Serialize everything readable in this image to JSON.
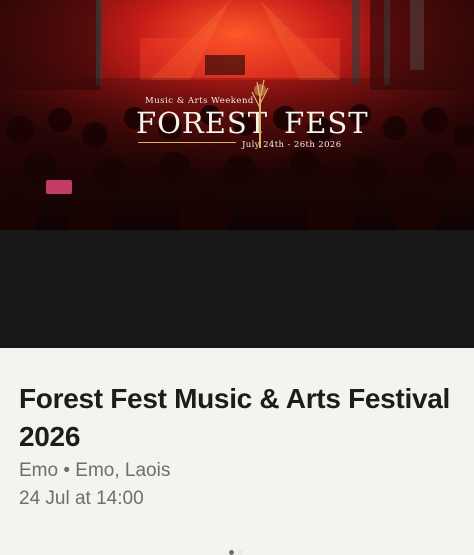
{
  "hero": {
    "logo_tagline": "Music & Arts Weekend",
    "logo_word_left": "FOREST",
    "logo_word_right": "FEST",
    "logo_dates": "July 24th - 26th 2026"
  },
  "carousel": {
    "page_count": 2,
    "active_index": 1
  },
  "event": {
    "title": "Forest Fest Music & Arts Festival 2026",
    "location": "Emo • Emo, Laois",
    "datetime": "24 Jul at 14:00"
  },
  "colors": {
    "accent_gold": "#d9b368",
    "hero_red": "#c8201a",
    "dark_band": "#171718"
  }
}
